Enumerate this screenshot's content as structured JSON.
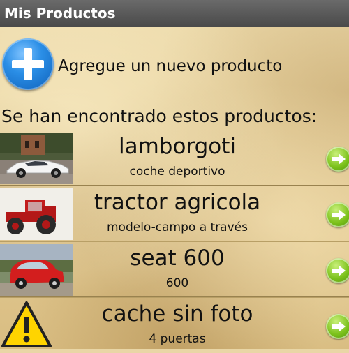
{
  "app": {
    "title": "Mis Productos"
  },
  "add": {
    "label": "Agregue un nuevo producto",
    "icon": "plus-icon"
  },
  "list": {
    "header": "Se han encontrado estos productos:",
    "items": [
      {
        "name": "lamborgoti",
        "description": "coche deportivo",
        "thumbnail": "white-sports-car-photo"
      },
      {
        "name": "tractor agricola",
        "description": "modelo-campo a través",
        "thumbnail": "red-tractor-photo"
      },
      {
        "name": "seat 600",
        "description": "600",
        "thumbnail": "red-seat-600-photo"
      },
      {
        "name": "cache sin foto",
        "description": "4 puertas",
        "thumbnail": "warning-icon"
      }
    ]
  },
  "colors": {
    "title_bar": "#4f4f4f",
    "add_button": "#1f78d6",
    "go_button": "#7cc21c",
    "background": "#e9d6a6"
  }
}
